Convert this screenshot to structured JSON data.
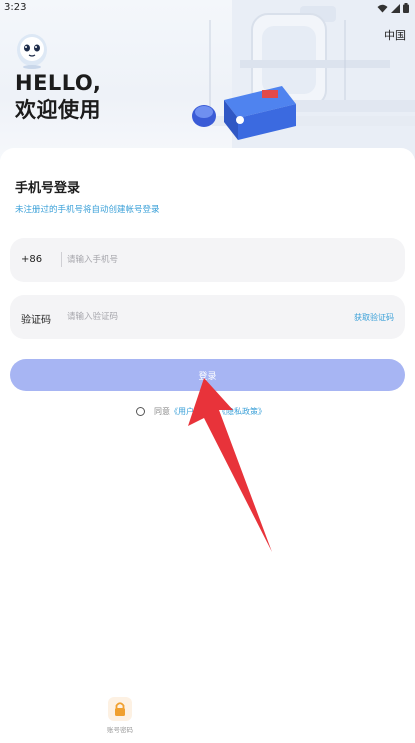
{
  "status_bar": {
    "time": "3:23",
    "icons": [
      "wifi-icon",
      "signal-icon",
      "battery-icon"
    ]
  },
  "header": {
    "region": "中国",
    "greeting_line1": "HELLO,",
    "greeting_line2": "欢迎使用"
  },
  "login": {
    "title": "手机号登录",
    "hint": "未注册过的手机号将自动创建帐号登录",
    "phone": {
      "country_code": "+86",
      "value": "",
      "placeholder": "请输入手机号"
    },
    "code": {
      "label": "验证码",
      "value": "",
      "placeholder": "请输入验证码",
      "get_code": "获取验证码"
    },
    "submit": "登录"
  },
  "agreement": {
    "checked": false,
    "prefix": "同意",
    "user_agreement": "《用户协议》",
    "privacy_policy": "《隐私政策》"
  },
  "footer": {
    "secure_label": "账号密码"
  },
  "colors": {
    "accent": "#3aa0d8",
    "button": "#a7b5f3",
    "arrow": "#e8333a"
  }
}
